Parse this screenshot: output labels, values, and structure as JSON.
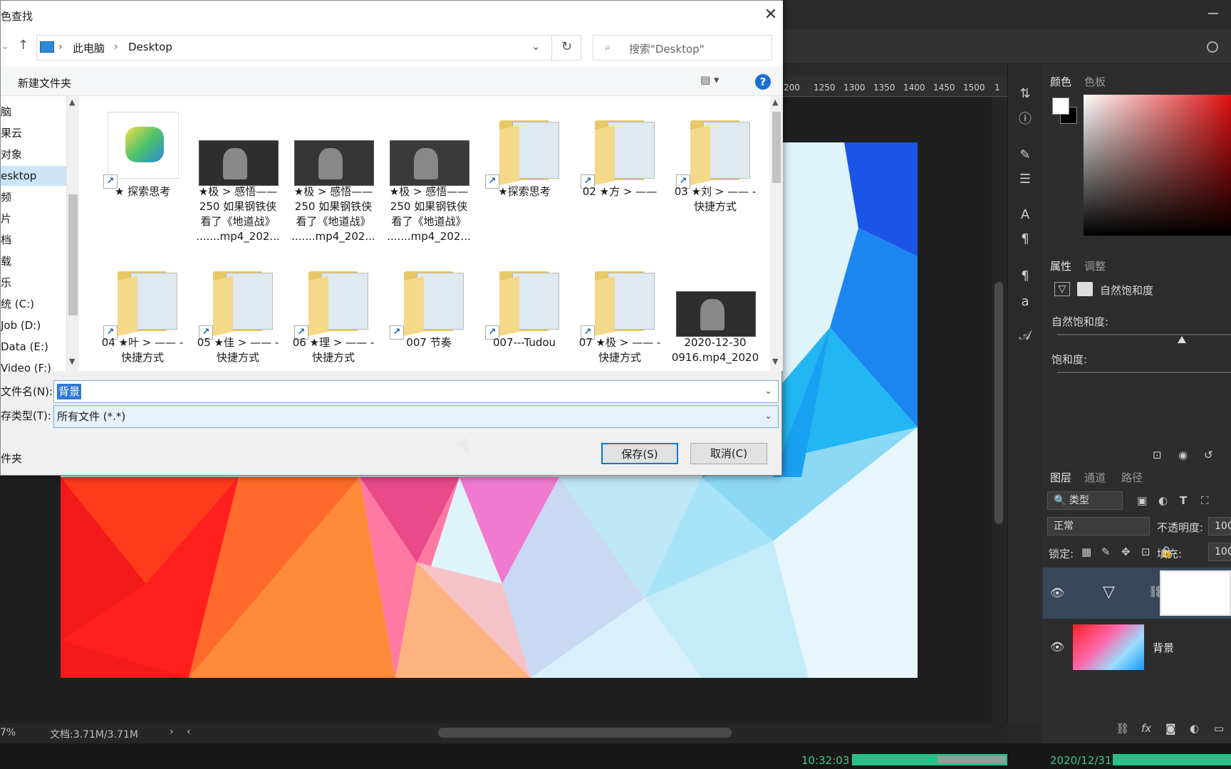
{
  "dialog": {
    "title": "色查找",
    "breadcrumb": [
      "此电脑",
      "Desktop"
    ],
    "search_placeholder": "搜索\"Desktop\"",
    "new_folder": "新建文件夹",
    "nav_items": [
      {
        "label": "脑",
        "selected": false
      },
      {
        "label": "果云",
        "selected": false
      },
      {
        "label": "对象",
        "selected": false
      },
      {
        "label": "esktop",
        "selected": true
      },
      {
        "label": "频",
        "selected": false
      },
      {
        "label": "片",
        "selected": false
      },
      {
        "label": "档",
        "selected": false
      },
      {
        "label": "载",
        "selected": false
      },
      {
        "label": "乐",
        "selected": false
      },
      {
        "label": "统 (C:)",
        "selected": false
      },
      {
        "label": "Job (D:)",
        "selected": false
      },
      {
        "label": "Data (E:)",
        "selected": false
      },
      {
        "label": "Video (F:)",
        "selected": false
      }
    ],
    "files": [
      {
        "label": "★ 探索思考",
        "kind": "app",
        "shortcut": true
      },
      {
        "label": "★极 > 感悟——\n250 如果钢铁侠\n看了《地道战》\n.......mp4_202...",
        "kind": "video",
        "shortcut": false
      },
      {
        "label": "★极 > 感悟——\n250 如果钢铁侠\n看了《地道战》\n.......mp4_202...",
        "kind": "video",
        "shortcut": false
      },
      {
        "label": "★极 > 感悟——\n250 如果钢铁侠\n看了《地道战》\n.......mp4_202...",
        "kind": "video",
        "shortcut": false
      },
      {
        "label": "★探索思考",
        "kind": "folder",
        "shortcut": true
      },
      {
        "label": "02 ★方 > ——",
        "kind": "folder",
        "shortcut": true
      },
      {
        "label": "03 ★刘 > —— -\n快捷方式",
        "kind": "folder",
        "shortcut": true
      },
      {
        "label": "04 ★叶 > —— -\n快捷方式",
        "kind": "folder",
        "shortcut": true
      },
      {
        "label": "05 ★佳 > —— -\n快捷方式",
        "kind": "folder",
        "shortcut": true
      },
      {
        "label": "06 ★理 > —— -\n快捷方式",
        "kind": "folder",
        "shortcut": true
      },
      {
        "label": "007 节奏",
        "kind": "folder",
        "shortcut": true
      },
      {
        "label": "007---Tudou",
        "kind": "folder",
        "shortcut": true
      },
      {
        "label": "07 ★极 > —— -\n快捷方式",
        "kind": "folder",
        "shortcut": true
      },
      {
        "label": "2020-12-30\n0916.mp4_2020",
        "kind": "video",
        "shortcut": false
      }
    ],
    "filename_label": "文件名(N):",
    "filename_value": "背景",
    "filetype_label": "存类型(T):",
    "filetype_value": "所有文件 (*.*)",
    "hide_folders": "件夹",
    "save_label": "保存(S)",
    "cancel_label": "取消(C)"
  },
  "photoshop": {
    "ruler_ticks": [
      "200",
      "1250",
      "1300",
      "1350",
      "1400",
      "1450",
      "1500",
      "1"
    ],
    "panels": {
      "color_tabs": [
        "颜色",
        "色板"
      ],
      "props_tabs": [
        "属性",
        "调整"
      ],
      "adjustment_name": "自然饱和度",
      "vibrance_label": "自然饱和度:",
      "saturation_label": "饱和度:",
      "layers_tabs": [
        "图层",
        "通道",
        "路径"
      ],
      "filter_kind": "类型",
      "blend_mode": "正常",
      "opacity_label": "不透明度:",
      "opacity_value": "100",
      "lock_label": "锁定:",
      "fill_label": "填充:",
      "fill_value": "100",
      "layer_background": "背景"
    },
    "status": {
      "zoom": "7%",
      "doc_info": "文档:3.71M/3.71M"
    }
  },
  "taskbar": {
    "time": "10:32:03",
    "date": "2020/12/31"
  }
}
